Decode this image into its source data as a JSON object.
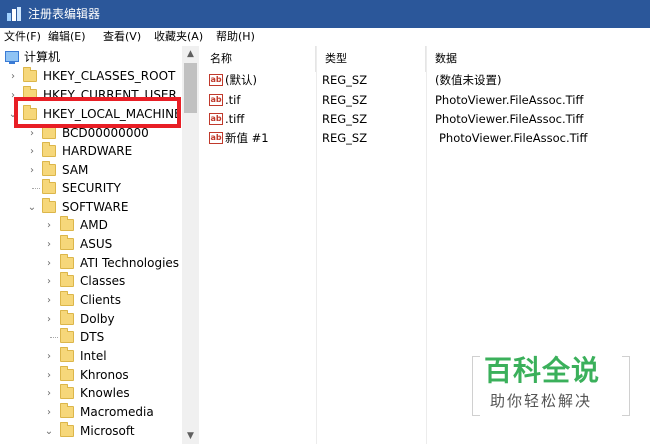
{
  "window": {
    "title": "注册表编辑器"
  },
  "menu": [
    {
      "label": "文件(F)"
    },
    {
      "label": "编辑(E)"
    },
    {
      "label": "查看(V)"
    },
    {
      "label": "收藏夹(A)"
    },
    {
      "label": "帮助(H)"
    }
  ],
  "tree": {
    "root": "计算机",
    "items": [
      {
        "label": "HKEY_CLASSES_ROOT",
        "arrow": "›"
      },
      {
        "label": "HKEY_CURRENT_USER",
        "arrow": "›"
      },
      {
        "label": "HKEY_LOCAL_MACHINE",
        "arrow": "⌄"
      },
      {
        "label": "BCD00000000",
        "arrow": "›"
      },
      {
        "label": "HARDWARE",
        "arrow": "›"
      },
      {
        "label": "SAM",
        "arrow": "›"
      },
      {
        "label": "SECURITY",
        "arrow": ""
      },
      {
        "label": "SOFTWARE",
        "arrow": "⌄"
      },
      {
        "label": "AMD",
        "arrow": "›"
      },
      {
        "label": "ASUS",
        "arrow": "›"
      },
      {
        "label": "ATI Technologies",
        "arrow": "›"
      },
      {
        "label": "Classes",
        "arrow": "›"
      },
      {
        "label": "Clients",
        "arrow": "›"
      },
      {
        "label": "Dolby",
        "arrow": "›"
      },
      {
        "label": "DTS",
        "arrow": ""
      },
      {
        "label": "Intel",
        "arrow": "›"
      },
      {
        "label": "Khronos",
        "arrow": "›"
      },
      {
        "label": "Knowles",
        "arrow": "›"
      },
      {
        "label": "Macromedia",
        "arrow": "›"
      },
      {
        "label": "Microsoft",
        "arrow": "⌄"
      }
    ]
  },
  "list": {
    "columns": [
      "名称",
      "类型",
      "数据"
    ],
    "rows": [
      {
        "name": "(默认)",
        "type": "REG_SZ",
        "data": "(数值未设置)"
      },
      {
        "name": ".tif",
        "type": "REG_SZ",
        "data": "PhotoViewer.FileAssoc.Tiff"
      },
      {
        "name": ".tiff",
        "type": "REG_SZ",
        "data": "PhotoViewer.FileAssoc.Tiff"
      },
      {
        "name": "新值 #1",
        "type": "REG_SZ",
        "data": "PhotoViewer.FileAssoc.Tiff"
      }
    ],
    "icon_text": "ab"
  },
  "watermark": {
    "title": "百科全说",
    "subtitle": "助你轻松解决"
  },
  "scrollbar": {
    "up": "▲",
    "down": "▼"
  }
}
